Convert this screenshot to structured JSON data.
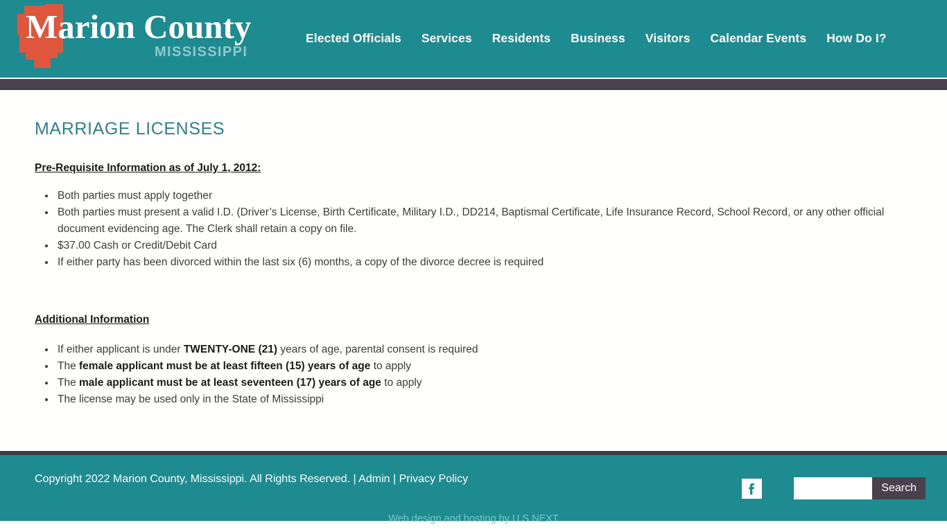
{
  "theme": {
    "teal": "#1e8b90",
    "dark_bar": "#4a414f",
    "logo_orange": "#e0563c",
    "heading_teal": "#2e8389",
    "subtitle_teal": "#8fc9cb"
  },
  "header": {
    "logo": {
      "icon": "marion-county-map-shape",
      "title": "Marion County",
      "subtitle": "MISSISSIPPI"
    },
    "nav": [
      {
        "label": "Elected Officials"
      },
      {
        "label": "Services"
      },
      {
        "label": "Residents"
      },
      {
        "label": "Business"
      },
      {
        "label": "Visitors"
      },
      {
        "label": "Calendar Events"
      },
      {
        "label": "How Do I?"
      }
    ]
  },
  "main": {
    "page_title": "MARRIAGE LICENSES",
    "prereq": {
      "heading": "Pre-Requisite Information as of July 1, 2012:",
      "items": [
        {
          "text": "Both parties must apply together"
        },
        {
          "text": "Both parties must present a valid I.D. (Driver’s License, Birth Certificate, Military I.D., DD214, Baptismal Certificate, Life Insurance Record, School Record, or any other official document evidencing age. The Clerk shall retain a copy on file."
        },
        {
          "text": "$37.00 Cash or Credit/Debit Card"
        },
        {
          "text": "If either party has been divorced within the last six (6) months, a copy of the divorce decree is required"
        }
      ]
    },
    "additional": {
      "heading": "Additional Information",
      "items": [
        {
          "pre": "If either applicant is under ",
          "strong": "TWENTY-ONE (21)",
          "post": " years of age, parental consent is required"
        },
        {
          "pre": "The ",
          "strong": "female applicant must be at least fifteen (15) years of age",
          "post": " to apply"
        },
        {
          "pre": "The ",
          "strong": "male applicant must be at least seventeen (17) years of age",
          "post": " to apply"
        },
        {
          "pre": "The license may be used only in the State of Mississippi",
          "strong": "",
          "post": ""
        }
      ]
    }
  },
  "footer": {
    "copyright": "Copyright 2022 Marion County, Mississippi. All Rights Reserved. | ",
    "admin_label": "Admin",
    "separator": " | ",
    "privacy_label": "Privacy Policy",
    "facebook_icon": "facebook-icon",
    "search": {
      "value": "",
      "placeholder": "",
      "button_label": "Search"
    },
    "credit": "Web design and hosting by U.S NEXT"
  }
}
